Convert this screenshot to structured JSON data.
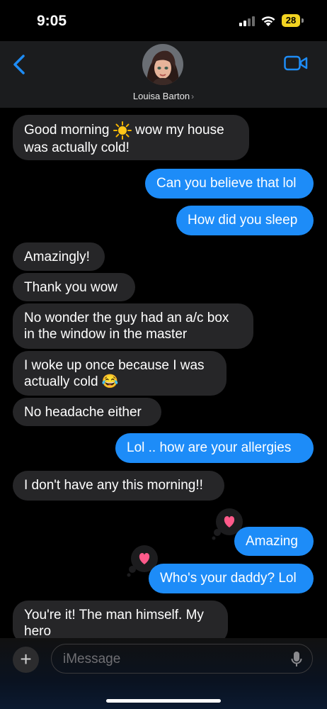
{
  "status_bar": {
    "time": "9:05",
    "battery": "28"
  },
  "header": {
    "contact_name": "Louisa Barton",
    "chevron": "›"
  },
  "messages": [
    {
      "line1a": "Good morning",
      "line1b": "wow my house",
      "line2": "was actually cold!"
    },
    {
      "text": "Can you believe that lol"
    },
    {
      "text": "How did you sleep"
    },
    {
      "text": "Amazingly!"
    },
    {
      "text": "Thank you wow"
    },
    {
      "line1": "No wonder the guy had an a/c box",
      "line2": "in the window in the master"
    },
    {
      "line1": "I woke up once because I was",
      "line2": "actually cold 😂"
    },
    {
      "text": "No headache either"
    },
    {
      "text": "Lol .. how are your allergies"
    },
    {
      "text": "I don't have any this morning!!"
    },
    {
      "text": "Amazing"
    },
    {
      "text": "Who's your daddy? Lol"
    },
    {
      "line1": "You're it! The man himself. My",
      "line2": "hero"
    }
  ],
  "input_bar": {
    "plus": "+",
    "placeholder": "iMessage"
  },
  "colors": {
    "outgoing": "#1d8cf8",
    "incoming": "#262628",
    "accent": "#1e8cf5",
    "heart": "#ff5a8a"
  }
}
